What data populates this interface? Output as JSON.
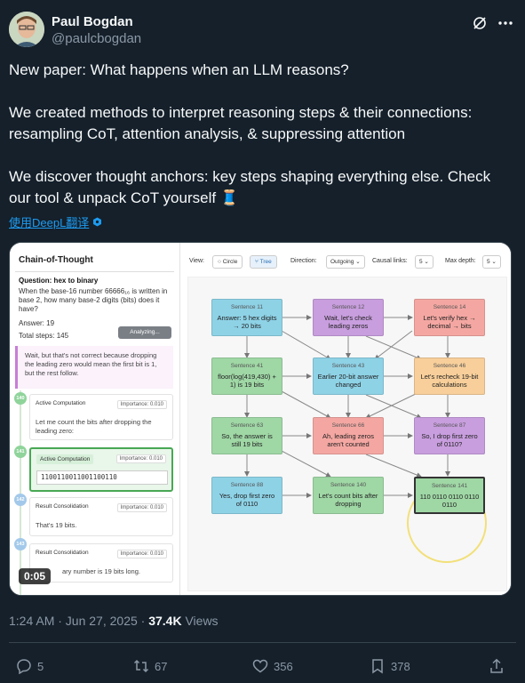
{
  "author": {
    "name": "Paul Bogdan",
    "handle": "@paulcbogdan"
  },
  "tweet": {
    "lines": [
      "New paper: What happens when an LLM reasons?",
      "We created methods to interpret reasoning steps & their connections:",
      "resampling CoT, attention analysis, & suppressing attention",
      "We discover thought anchors: key steps shaping everything else. Check",
      "our tool & unpack CoT yourself 🧵"
    ],
    "translate": "使用DeepL翻译"
  },
  "media": {
    "left": {
      "title": "Chain-of-Thought",
      "question_title": "Question: hex to binary",
      "question_text": "When the base-16 number 66666₁₆ is written in base 2, how many base-2 digits (bits) does it have?",
      "answer": "Answer: 19",
      "total_steps": "Total steps: 145",
      "analyze_button": "Analyzing...",
      "pink_text": "Wait, but that's not correct because dropping the leading zero would mean the first bit is 1, but the rest follow.",
      "steps": [
        {
          "num": "140",
          "head": "Active Computation",
          "importance": "Importance: 0.010",
          "body": "Let me count the bits after dropping the leading zero:"
        },
        {
          "num": "141",
          "head": "Active Computation",
          "importance": "Importance: 0.010",
          "body": "1100110011001100110"
        },
        {
          "num": "142",
          "head": "Result Consolidation",
          "importance": "Importance: 0.010",
          "body": "That's 19 bits."
        },
        {
          "num": "143",
          "head": "Result Consolidation",
          "importance": "Importance: 0.010",
          "body": "ary number is 19 bits long."
        }
      ],
      "timer": "0:05"
    },
    "right": {
      "view_label": "View:",
      "view_circle": "Circle",
      "view_tree": "Tree",
      "direction_label": "Direction:",
      "direction_value": "Outgoing",
      "causal_label": "Causal links:",
      "causal_value": "5",
      "depth_label": "Max depth:",
      "depth_value": "5",
      "nodes": [
        {
          "id": "s11",
          "title": "Sentence 11",
          "text": "Answer: 5 hex digits → 20 bits",
          "color": "blue"
        },
        {
          "id": "s12",
          "title": "Sentence 12",
          "text": "Wait, let's check leading zeros",
          "color": "purple"
        },
        {
          "id": "s14",
          "title": "Sentence 14",
          "text": "Let's verify hex → decimal → bits",
          "color": "red"
        },
        {
          "id": "s41",
          "title": "Sentence 41",
          "text": "floor(log(419,430) + 1) is 19 bits",
          "color": "green"
        },
        {
          "id": "s43",
          "title": "Sentence 43",
          "text": "Earlier 20-bit answer changed",
          "color": "blue"
        },
        {
          "id": "s46",
          "title": "Sentence 46",
          "text": "Let's recheck 19-bit calculations",
          "color": "orange"
        },
        {
          "id": "s63",
          "title": "Sentence 63",
          "text": "So, the answer is still 19 bits",
          "color": "green"
        },
        {
          "id": "s66",
          "title": "Sentence 66",
          "text": "Ah, leading zeros aren't counted",
          "color": "red"
        },
        {
          "id": "s87",
          "title": "Sentence 87",
          "text": "So, I drop first zero of 0110?",
          "color": "purple"
        },
        {
          "id": "s88",
          "title": "Sentence 88",
          "text": "Yes, drop first zero of 0110",
          "color": "blue"
        },
        {
          "id": "s140",
          "title": "Sentence 140",
          "text": "Let's count bits after dropping",
          "color": "green"
        },
        {
          "id": "s141",
          "title": "Sentence 141",
          "text": "110 0110 0110 0110 0110",
          "color": "green"
        }
      ]
    }
  },
  "meta": {
    "time": "1:24 AM · Jun 27, 2025 · ",
    "views_count": "37.4K",
    "views_label": " Views"
  },
  "actions": {
    "replies": "5",
    "reposts": "67",
    "likes": "356",
    "bookmarks": "378"
  }
}
